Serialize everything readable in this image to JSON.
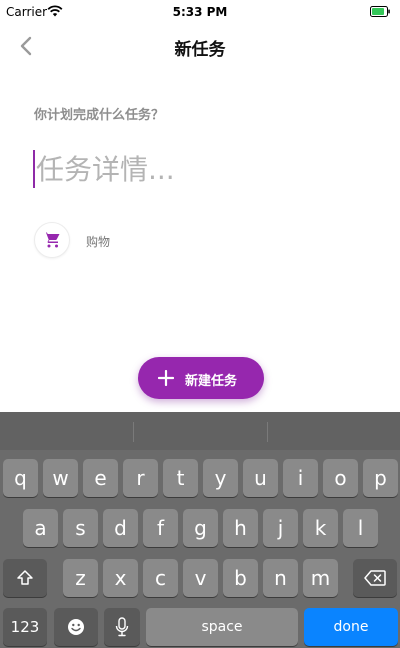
{
  "status": {
    "carrier": "Carrier",
    "time": "5:33 PM"
  },
  "nav": {
    "title": "新任务"
  },
  "form": {
    "question": "你计划完成什么任务？",
    "task_placeholder": "任务详情...",
    "task_value": "",
    "category_label": "购物"
  },
  "fab": {
    "label": "新建任务"
  },
  "keyboard": {
    "row1": [
      "q",
      "w",
      "e",
      "r",
      "t",
      "y",
      "u",
      "i",
      "o",
      "p"
    ],
    "row2": [
      "a",
      "s",
      "d",
      "f",
      "g",
      "h",
      "j",
      "k",
      "l"
    ],
    "row3": [
      "z",
      "x",
      "c",
      "v",
      "b",
      "n",
      "m"
    ],
    "numbers_label": "123",
    "space_label": "space",
    "done_label": "done"
  },
  "colors": {
    "accent": "#9627ae",
    "done": "#0a84ff"
  },
  "icons": [
    "wifi-icon",
    "battery-icon",
    "back-chevron-icon",
    "shopping-cart-icon",
    "plus-icon",
    "shift-icon",
    "delete-icon",
    "emoji-icon",
    "mic-icon"
  ]
}
